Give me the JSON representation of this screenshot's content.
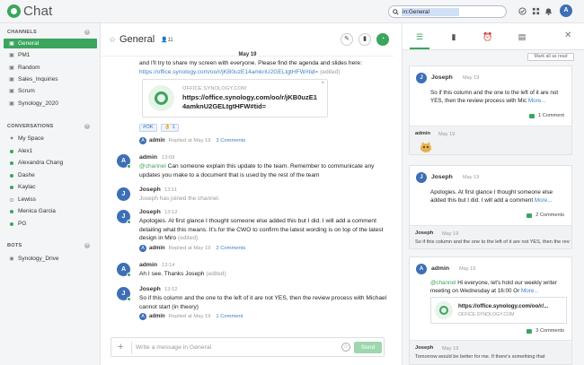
{
  "app": {
    "name": "Chat"
  },
  "search": {
    "value": "in:General"
  },
  "user": {
    "initial": "A"
  },
  "sidebar": {
    "channels_label": "CHANNELS",
    "channels": [
      "General",
      "PM1",
      "Random",
      "Sales_Inquiries",
      "Scrum",
      "Synology_2020"
    ],
    "conversations_label": "CONVERSATIONS",
    "conversations": [
      {
        "name": "My Space",
        "status": "none"
      },
      {
        "name": "Alex1",
        "status": "online"
      },
      {
        "name": "Alexandra Chang",
        "status": "online"
      },
      {
        "name": "Dashe",
        "status": "online"
      },
      {
        "name": "Kaylac",
        "status": "online"
      },
      {
        "name": "Lewiss",
        "status": "offline"
      },
      {
        "name": "Menica Garcia",
        "status": "online"
      },
      {
        "name": "PG",
        "status": "online"
      }
    ],
    "bots_label": "BOTS",
    "bots": [
      "Synology_Drive"
    ]
  },
  "channel": {
    "title": "General",
    "member_count": "11"
  },
  "thread": {
    "date": "May 19",
    "first_text": "and I'll try to share my screen with everyone. Please find the agenda and slides here:",
    "first_link": "https://office.synology.com/oo/r/jKB0uzE14amknU2GELtgtHFW#tid=",
    "first_edited": "(edited)",
    "preview": {
      "site": "OFFICE.SYNOLOGY.COM",
      "url": "https://office.synology.com/oo/r/jKB0uzE14amknU2GELtgtHFW#tid=",
      "close": "×"
    },
    "reactions": [
      "#OK",
      "👌 1"
    ],
    "reply1": {
      "avatar": "A",
      "name": "admin",
      "meta": "Replied at May 19",
      "count": "3 Comments"
    },
    "msg2": {
      "avatar": "A",
      "name": "admin",
      "time": "13:09",
      "mention": "@channel",
      "text": " Can someone explain this update to the team. Remember to communicate any updates you make to a document that is used by the rest of the team"
    },
    "msg3": {
      "avatar": "J",
      "name": "Joseph",
      "time": "13:11",
      "text": "Joseph has joined the channel."
    },
    "msg4": {
      "avatar": "J",
      "name": "Joseph",
      "time": "13:12",
      "text": "Apologies. At first glance I thought someone else added this but I did. I will add a comment detailing what this means. It's for the CWO to confirm the latest wording is on top of the latest design in Miro",
      "edited": "(edited)"
    },
    "reply4": {
      "avatar": "A",
      "name": "admin",
      "meta": "Replied at May 19",
      "count": "2 Comments"
    },
    "msg5": {
      "avatar": "A",
      "name": "admin",
      "time": "13:14",
      "text": "Ah I see. Thanks Joseph",
      "edited": "(edited)"
    },
    "msg6": {
      "avatar": "J",
      "name": "Joseph",
      "time": "13:12",
      "text": "So if this column and the one to the left of it are not YES, then the review process with Michael cannot start (in theory)"
    },
    "reply6": {
      "avatar": "A",
      "name": "admin",
      "meta": "Replied at May 19",
      "count": "1 Comment"
    }
  },
  "composer": {
    "placeholder": "Write a message in General",
    "send": "Send"
  },
  "right_panel": {
    "mark_all": "Mark all as read",
    "cards": [
      {
        "avatar": "J",
        "name": "Joseph",
        "time": "May 19",
        "text": "So if this column and the one to the left of it are not YES, then the review process with Mic",
        "more": "More...",
        "count": "1 Comment",
        "foot_name": "admin",
        "foot_time": "May 19"
      },
      {
        "avatar": "J",
        "name": "Joseph",
        "time": "May 19",
        "text": "Apologies. At first glance I thought someone else added this but I did. I will add a comment",
        "more": "More...",
        "count": "2 Comments",
        "foot_name": "Joseph",
        "foot_time": "May 19",
        "foot_text": "So if this column and the one to the left of it are not YES, then the review proc"
      },
      {
        "avatar": "A",
        "name": "admin",
        "time": "May 19",
        "mention": "@channel",
        "text": " Hi everyone, let's hold our weekly writer meeting on Wednesday at 16:00 Or",
        "more": "More...",
        "preview_url": "https://office.synology.com/oo/r/...",
        "preview_site": "OFFICE.SYNOLOGY.COM",
        "count": "3 Comments",
        "foot_name": "Joseph",
        "foot_time": "May 19",
        "foot_text": "Tomorrow would be better for me. If there's something that"
      }
    ]
  },
  "colors": {
    "accent": "#3ba55d",
    "avatar": "#3d6fb7",
    "link": "#3d82c4"
  },
  "icons": [
    "search-icon",
    "check-circle-icon",
    "grid-icon",
    "bell-icon",
    "star-icon",
    "members-icon",
    "pin-icon",
    "bookmark-icon",
    "chat-icon",
    "threads-icon",
    "alarm-icon",
    "files-icon",
    "close-icon",
    "plus-icon",
    "emoji-icon"
  ]
}
